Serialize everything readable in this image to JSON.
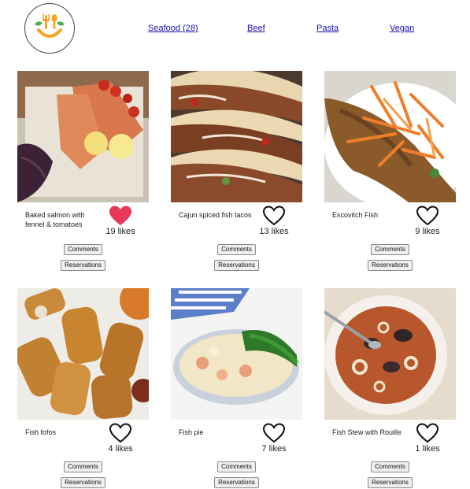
{
  "nav": {
    "links": [
      {
        "label": "Seafood (28)"
      },
      {
        "label": "Beef"
      },
      {
        "label": "Pasta"
      },
      {
        "label": "Vegan"
      }
    ]
  },
  "colors": {
    "link": "#1a0dab",
    "liked_heart": "#e8375a",
    "logo_orange": "#f5a524"
  },
  "cards": [
    {
      "title": "Baked salmon with fennel & tomatoes",
      "likes": "19 likes",
      "liked": true,
      "comments_label": "Comments",
      "reservations_label": "Reservations",
      "icon": "heart-filled-icon"
    },
    {
      "title": "Cajun spiced fish tacos",
      "likes": "13 likes",
      "liked": false,
      "comments_label": "Comments",
      "reservations_label": "Reservations",
      "icon": "heart-outline-icon"
    },
    {
      "title": "Escovitch Fish",
      "likes": "9 likes",
      "liked": false,
      "comments_label": "Comments",
      "reservations_label": "Reservations",
      "icon": "heart-outline-icon"
    },
    {
      "title": "Fish fofos",
      "likes": "4 likes",
      "liked": false,
      "comments_label": "Comments",
      "reservations_label": "Reservations",
      "icon": "heart-outline-icon"
    },
    {
      "title": "Fish pie",
      "likes": "7 likes",
      "liked": false,
      "comments_label": "Comments",
      "reservations_label": "Reservations",
      "icon": "heart-outline-icon"
    },
    {
      "title": "Fish Stew with Rouille",
      "likes": "1 likes",
      "liked": false,
      "comments_label": "Comments",
      "reservations_label": "Reservations",
      "icon": "heart-outline-icon"
    }
  ]
}
